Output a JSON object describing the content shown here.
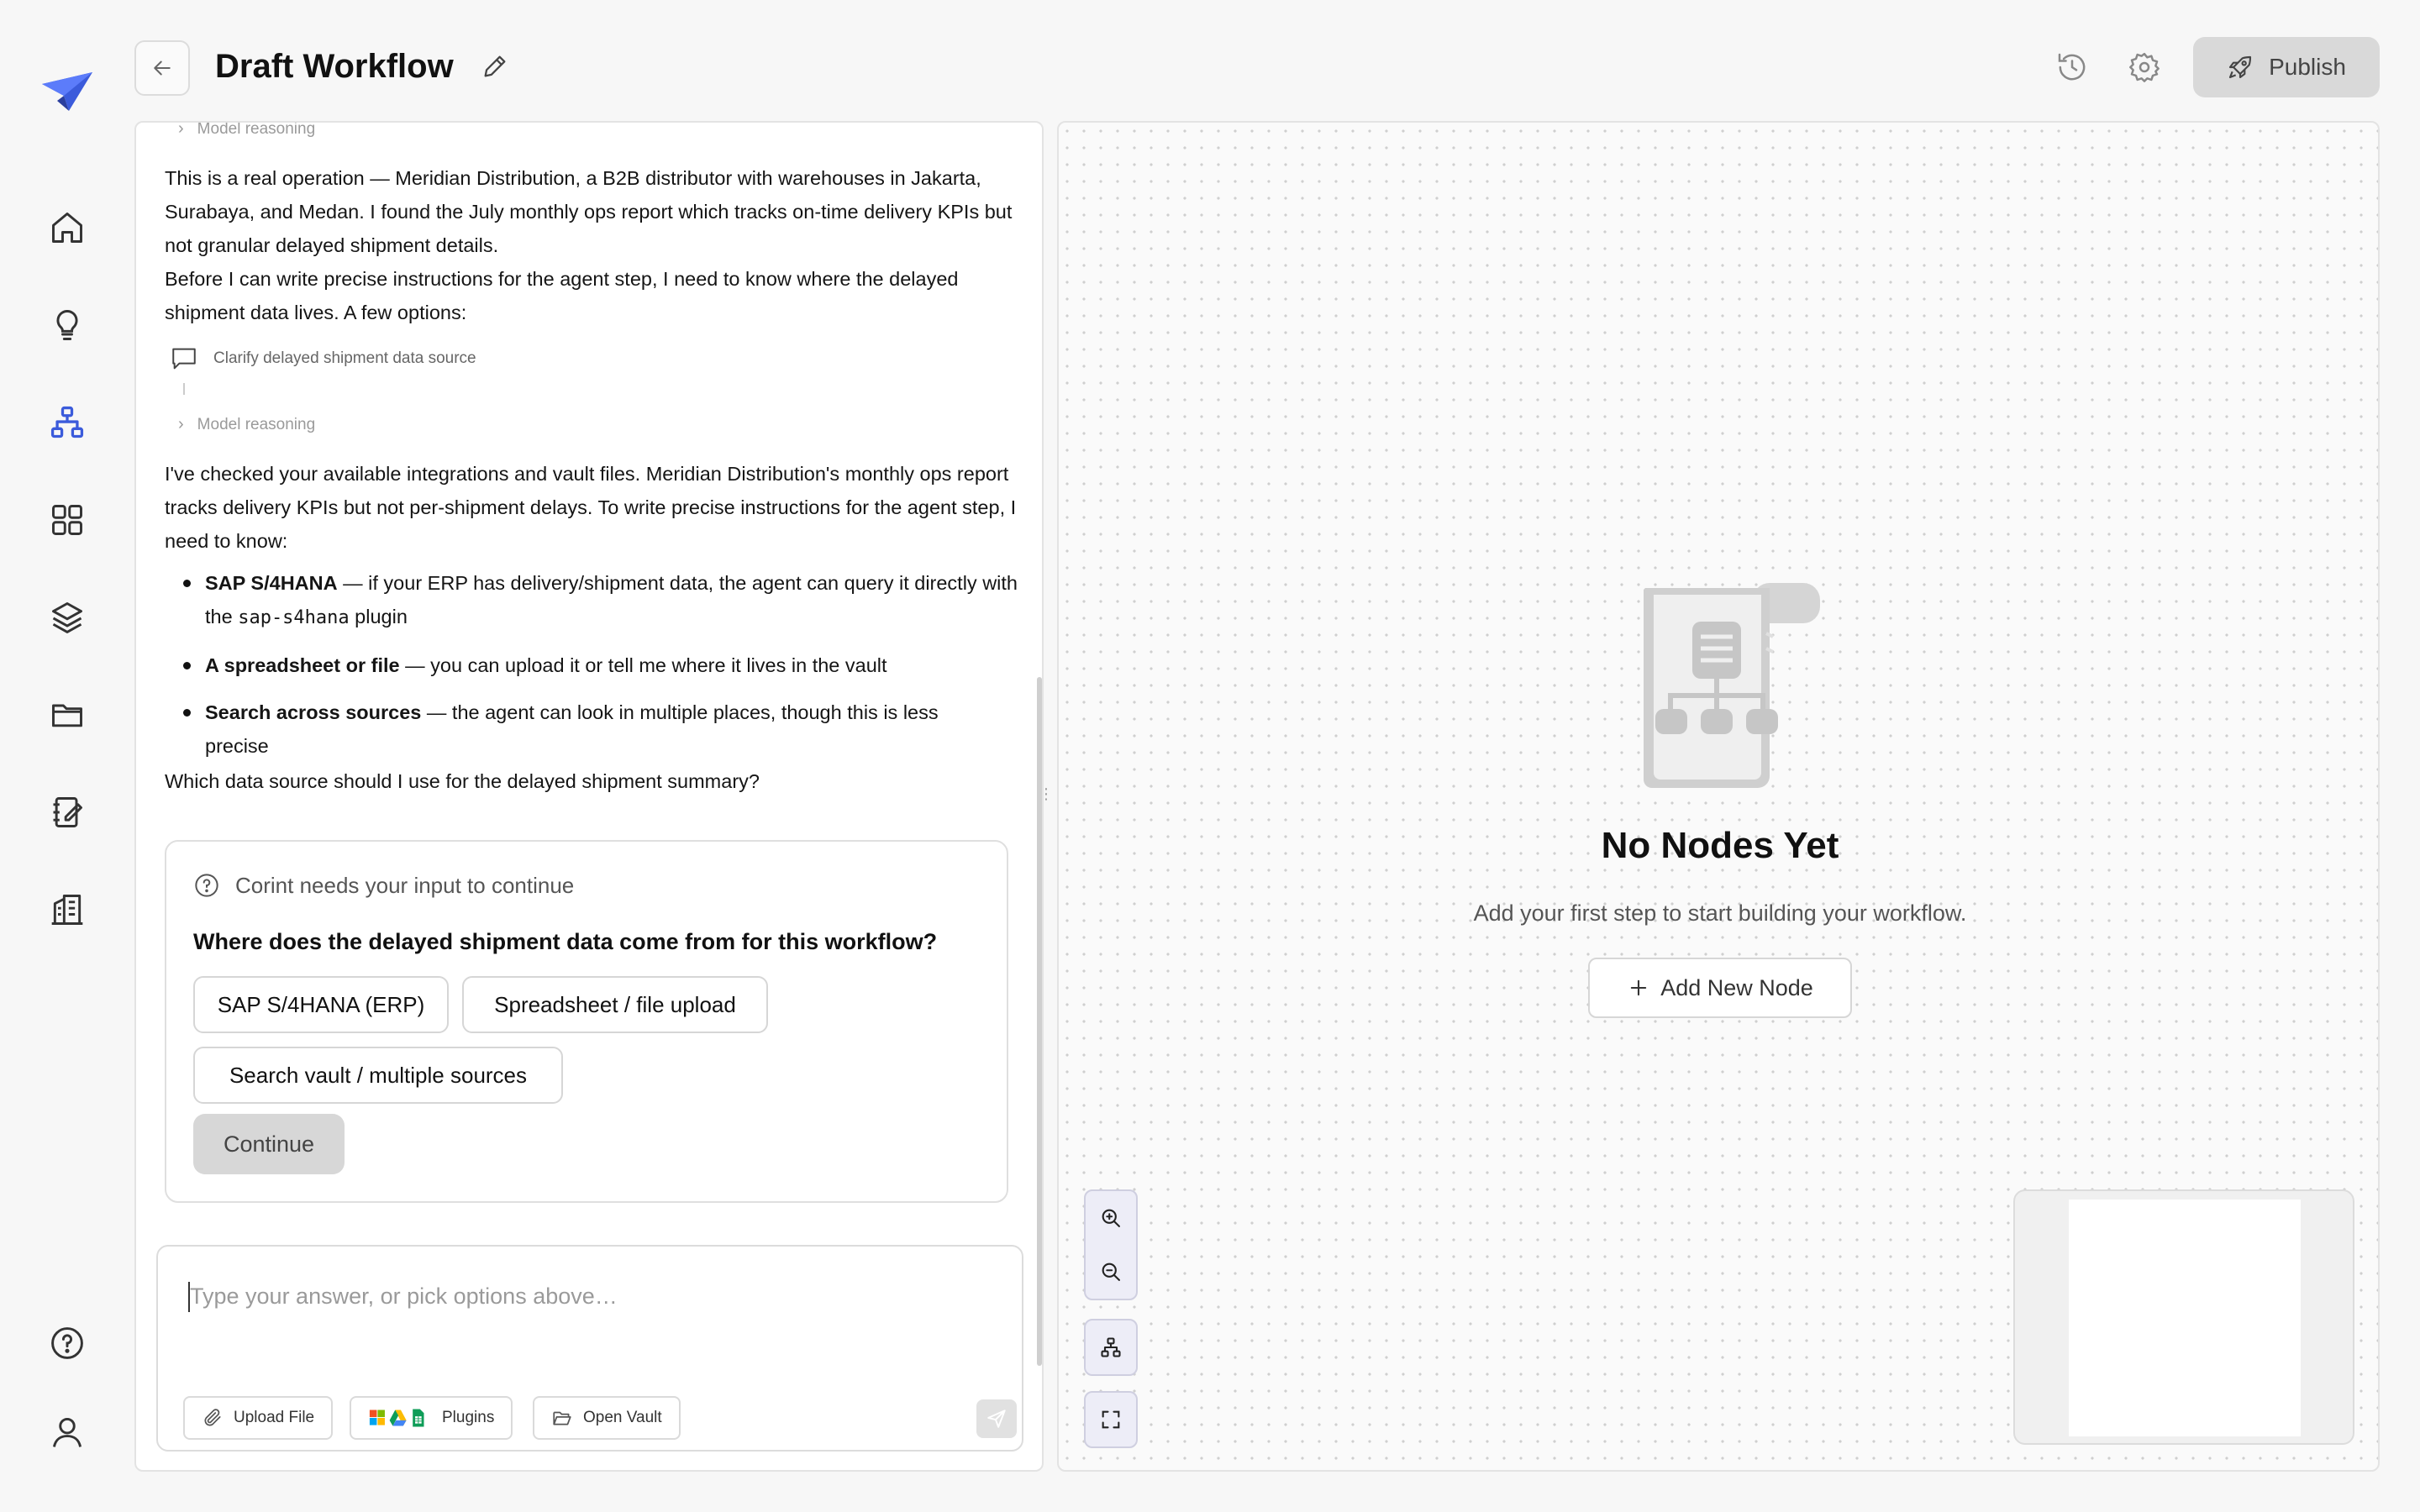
{
  "header": {
    "title": "Draft Workflow",
    "publish_label": "Publish"
  },
  "sidebar": {
    "items": [
      {
        "name": "home",
        "icon": "home-icon"
      },
      {
        "name": "ideas",
        "icon": "lightbulb-icon"
      },
      {
        "name": "workflows",
        "icon": "workflow-icon",
        "active": true
      },
      {
        "name": "apps",
        "icon": "grid-icon"
      },
      {
        "name": "layers",
        "icon": "layers-icon"
      },
      {
        "name": "files",
        "icon": "folder-icon"
      },
      {
        "name": "notes",
        "icon": "notebook-icon"
      },
      {
        "name": "organization",
        "icon": "building-icon"
      }
    ],
    "bottom": [
      {
        "name": "help",
        "icon": "help-icon"
      },
      {
        "name": "profile",
        "icon": "user-icon"
      }
    ],
    "accent_color": "#3b5bdb"
  },
  "chat": {
    "reasoning_label": "Model reasoning",
    "message1_p1": "This is a real operation — Meridian Distribution, a B2B distributor with warehouses in Jakarta, Surabaya, and Medan. I found the July monthly ops report which tracks on-time delivery KPIs but not granular delayed shipment details.",
    "message1_p2": "Before I can write precise instructions for the agent step, I need to know where the delayed shipment data lives. A few options:",
    "tool_call_label": "Clarify delayed shipment data source",
    "message2_p1": "I've checked your available integrations and vault files. Meridian Distribution's monthly ops report tracks delivery KPIs but not per-shipment delays. To write precise instructions for the agent step, I need to know:",
    "bullets": [
      {
        "bold": "SAP S/4HANA",
        "text_a": " — if your ERP has delivery/shipment data, the agent can query it directly with the ",
        "code": "sap-s4hana",
        "text_b": " plugin"
      },
      {
        "bold": "A spreadsheet or file",
        "text_a": " — you can upload it or tell me where it lives in the vault"
      },
      {
        "bold": "Search across sources",
        "text_a": " — the agent can look in multiple places, though this is less precise"
      }
    ],
    "closing_question": "Which data source should I use for the delayed shipment summary?"
  },
  "question_card": {
    "header": "Corint needs your input to continue",
    "question": "Where does the delayed shipment data come from for this workflow?",
    "options": [
      "SAP S/4HANA (ERP)",
      "Spreadsheet / file upload",
      "Search vault / multiple sources"
    ],
    "continue_label": "Continue"
  },
  "composer": {
    "placeholder": "Type your answer, or pick options above…",
    "upload_label": "Upload File",
    "plugins_label": "Plugins",
    "vault_label": "Open Vault"
  },
  "canvas": {
    "empty_title": "No Nodes Yet",
    "empty_subtitle": "Add your first step to start building your workflow.",
    "add_node_label": "Add New Node"
  }
}
